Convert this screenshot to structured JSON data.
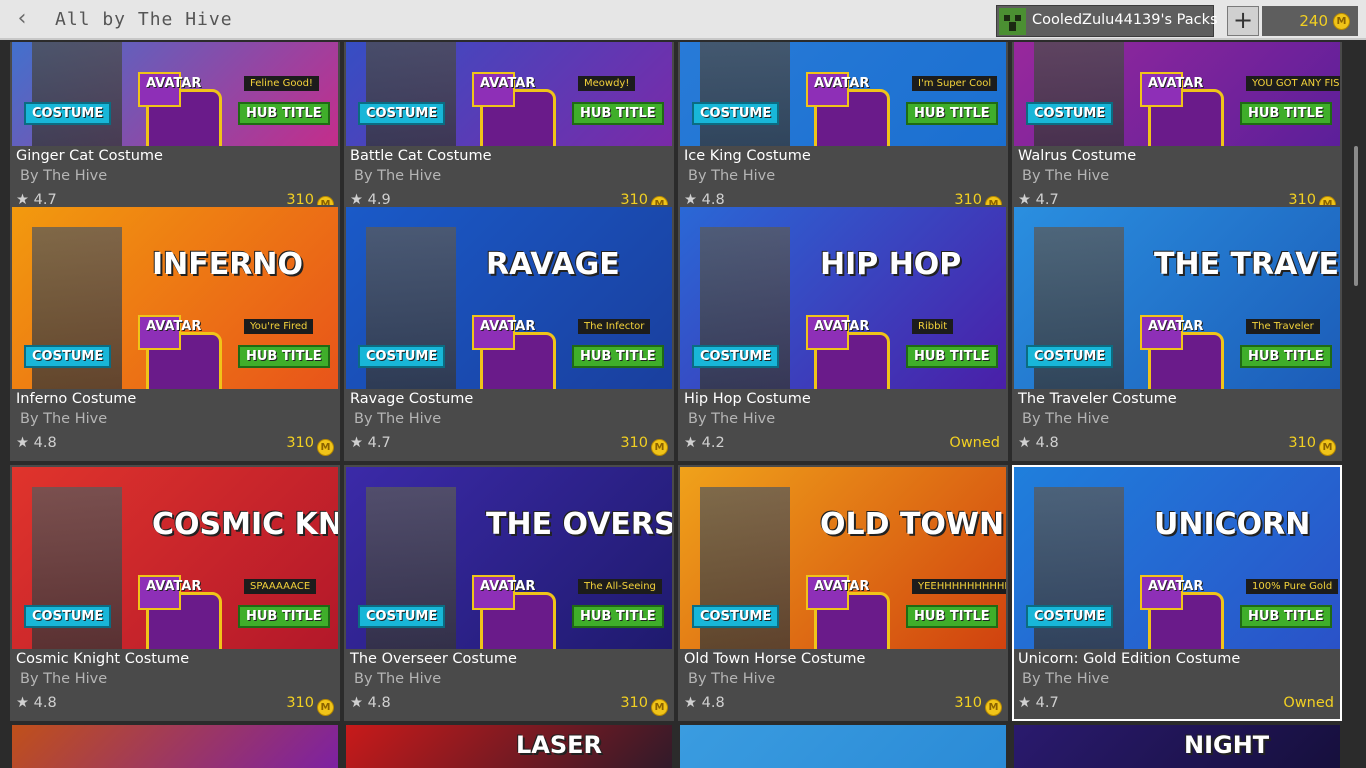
{
  "header": {
    "title": "All by The Hive",
    "packs_label": "CooledZulu44139's Packs",
    "add_label": "+",
    "balance": "240"
  },
  "coin_symbol": "M",
  "tiles": [
    {
      "name": "Ginger Cat Costume",
      "by": "By The Hive",
      "rating": "★ 4.7",
      "price": "310",
      "owned": "",
      "banner": "",
      "sub": "Feline Good!",
      "colors": [
        "#2a7dd9",
        "#c42d8b"
      ]
    },
    {
      "name": "Battle Cat Costume",
      "by": "By The Hive",
      "rating": "★ 4.9",
      "price": "310",
      "owned": "",
      "banner": "",
      "sub": "Meowdy!",
      "colors": [
        "#2a55c9",
        "#7a2aa8"
      ]
    },
    {
      "name": "Ice King Costume",
      "by": "By The Hive",
      "rating": "★ 4.8",
      "price": "310",
      "owned": "",
      "banner": "",
      "sub": "I'm Super Cool",
      "colors": [
        "#2a7dd9",
        "#1b6fd0"
      ]
    },
    {
      "name": "Walrus Costume",
      "by": "By The Hive",
      "rating": "★ 4.7",
      "price": "310",
      "owned": "",
      "banner": "",
      "sub": "YOU GOT ANY FISH??",
      "colors": [
        "#a32a9d",
        "#5c1f9a"
      ]
    },
    {
      "name": "Inferno Costume",
      "by": "By The Hive",
      "rating": "★ 4.8",
      "price": "310",
      "owned": "",
      "banner": "INFERNO",
      "sub": "You're Fired",
      "colors": [
        "#f29a0e",
        "#e8541a"
      ]
    },
    {
      "name": "Ravage Costume",
      "by": "By The Hive",
      "rating": "★ 4.7",
      "price": "310",
      "owned": "",
      "banner": "RAVAGE",
      "sub": "The Infector",
      "colors": [
        "#1a5ac8",
        "#1a3f9e"
      ]
    },
    {
      "name": "Hip Hop Costume",
      "by": "By The Hive",
      "rating": "★ 4.2",
      "price": "",
      "owned": "Owned",
      "banner": "HIP HOP",
      "sub": "Ribbit",
      "colors": [
        "#2a68d6",
        "#4a1fa8"
      ]
    },
    {
      "name": "The Traveler Costume",
      "by": "By The Hive",
      "rating": "★ 4.8",
      "price": "310",
      "owned": "",
      "banner": "THE TRAVELER",
      "sub": "The Traveler",
      "colors": [
        "#2a8fe0",
        "#1c5cb8"
      ]
    },
    {
      "name": "Cosmic Knight Costume",
      "by": "By The Hive",
      "rating": "★ 4.8",
      "price": "310",
      "owned": "",
      "banner": "COSMIC KNIGHT",
      "sub": "SPAAAAACE",
      "colors": [
        "#e0342c",
        "#b3182a"
      ]
    },
    {
      "name": "The Overseer Costume",
      "by": "By The Hive",
      "rating": "★ 4.8",
      "price": "310",
      "owned": "",
      "banner": "THE OVERSEER",
      "sub": "The All-Seeing",
      "colors": [
        "#3b2aa8",
        "#1f1a6e"
      ]
    },
    {
      "name": "Old Town Horse Costume",
      "by": "By The Hive",
      "rating": "★ 4.8",
      "price": "310",
      "owned": "",
      "banner": "OLD TOWN HORSE",
      "sub": "YEEHHHHHHHHHHH",
      "colors": [
        "#f0a21a",
        "#d0420f"
      ]
    },
    {
      "name": "Unicorn: Gold Edition Costume",
      "by": "By The Hive",
      "rating": "★ 4.7",
      "price": "",
      "owned": "Owned",
      "banner": "UNICORN",
      "sub": "100% Pure Gold",
      "colors": [
        "#1f7fdc",
        "#2a52c8"
      ]
    }
  ],
  "tile_tags": {
    "costume": "COSTUME",
    "avatar": "AVATAR",
    "hub": "HUB TITLE"
  },
  "partial_tiles": [
    {
      "colors": [
        "#c0501a",
        "#7a1fa8"
      ]
    },
    {
      "colors": [
        "#c81a1a",
        "#2a1a2a"
      ],
      "banner": "LASER"
    },
    {
      "colors": [
        "#3a9ce0",
        "#2a8ad6"
      ]
    },
    {
      "colors": [
        "#2a1a6e",
        "#150f3a"
      ],
      "banner": "NIGHT"
    }
  ]
}
